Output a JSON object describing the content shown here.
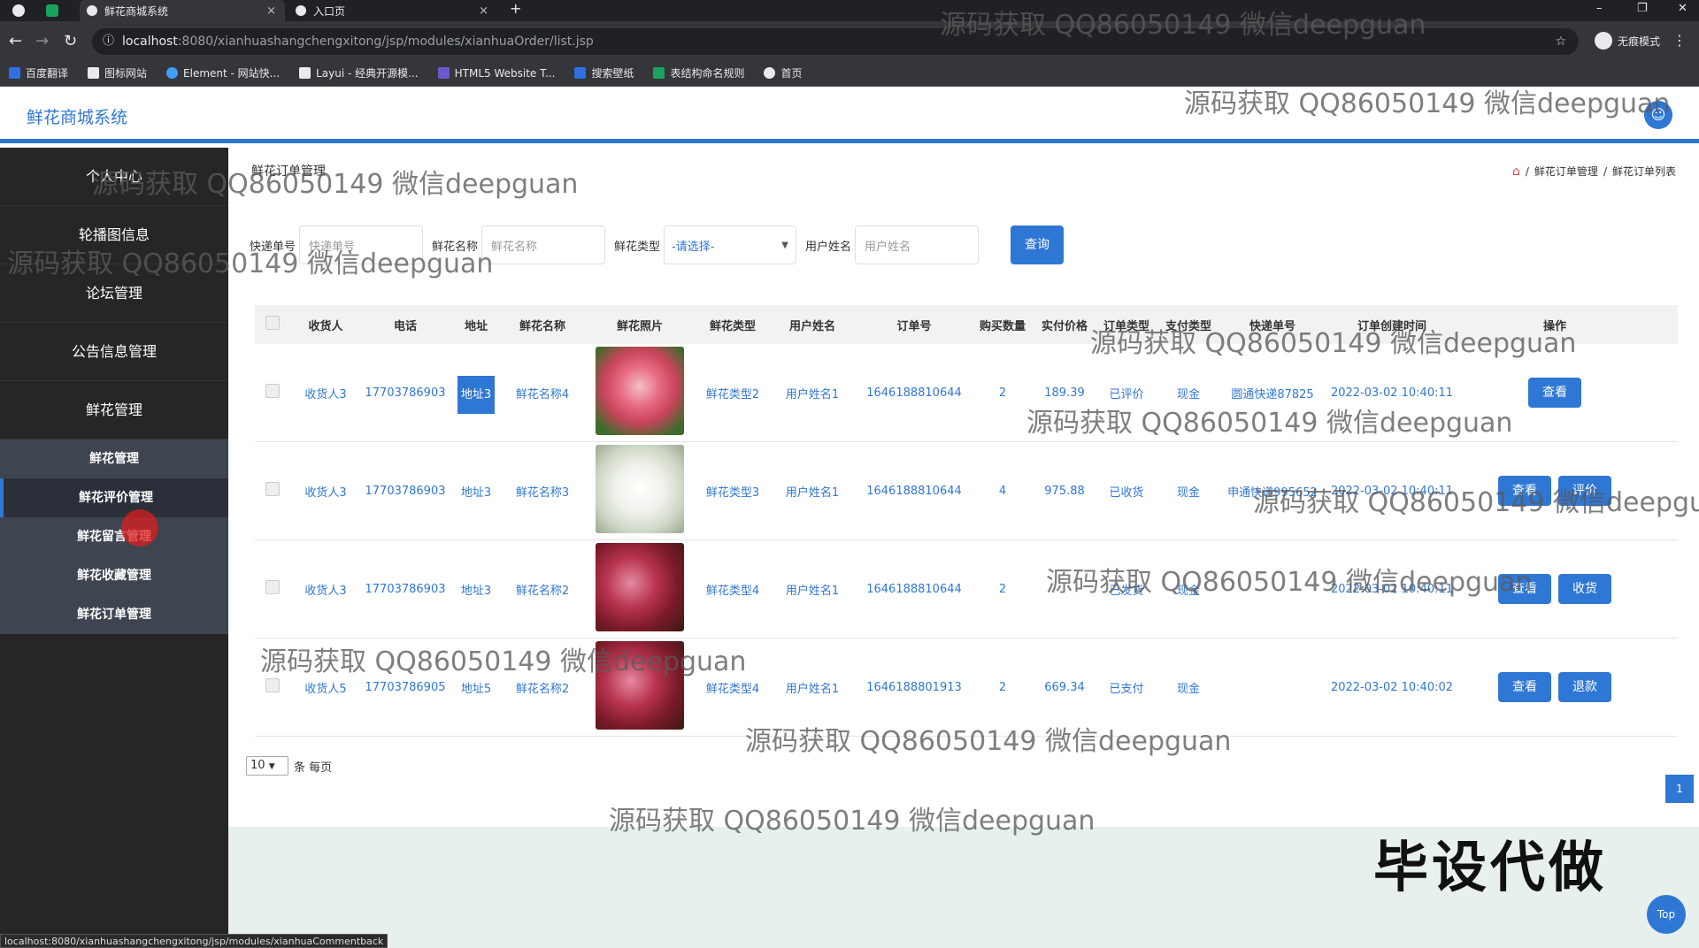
{
  "browser": {
    "tabs": [
      {
        "title": "鲜花商城系统",
        "close": "×"
      },
      {
        "title": "入口页",
        "close": "×"
      }
    ],
    "new_tab": "+",
    "window_controls": [
      "–",
      "❐",
      "✕"
    ],
    "url_host": "localhost",
    "url_path": ":8080/xianhuashangchengxitong/jsp/modules/xianhuaOrder/list.jsp",
    "incognito_label": "无痕模式",
    "bookmarks": [
      {
        "label": "百度翻译",
        "color": "#2f6fe0"
      },
      {
        "label": "图标网站",
        "color": "#e8eaed"
      },
      {
        "label": "Element - 网站快...",
        "color": "#409eff"
      },
      {
        "label": "Layui - 经典开源模...",
        "color": "#e8eaed"
      },
      {
        "label": "HTML5 Website T...",
        "color": "#6a5acd"
      },
      {
        "label": "搜索壁纸",
        "color": "#2f6fe0"
      },
      {
        "label": "表结构命名规则",
        "color": "#1aa260"
      },
      {
        "label": "首页",
        "color": "#e8eaed"
      }
    ],
    "status_url": "localhost:8080/xianhuashangchengxitong/jsp/modules/xianhuaCommentback"
  },
  "header": {
    "title": "鲜花商城系统",
    "avatar_icon": "user-icon"
  },
  "sidebar": {
    "items": [
      {
        "label": "个人中心"
      },
      {
        "label": "轮播图信息"
      },
      {
        "label": "论坛管理"
      },
      {
        "label": "公告信息管理"
      },
      {
        "label": "鲜花管理"
      }
    ],
    "subitems": [
      {
        "label": "鲜花管理"
      },
      {
        "label": "鲜花评价管理"
      },
      {
        "label": "鲜花留言管理"
      },
      {
        "label": "鲜花收藏管理"
      },
      {
        "label": "鲜花订单管理"
      }
    ]
  },
  "main": {
    "page_title": "鲜花订单管理",
    "breadcrumb": [
      "鲜花订单管理",
      "鲜花订单列表"
    ],
    "breadcrumb_sep": "/",
    "search": {
      "fields": [
        {
          "label": "快递单号",
          "placeholder": "快递单号"
        },
        {
          "label": "鲜花名称",
          "placeholder": "鲜花名称"
        },
        {
          "label": "鲜花类型",
          "select": "-请选择-"
        },
        {
          "label": "用户姓名",
          "placeholder": "用户姓名"
        }
      ],
      "button": "查询"
    },
    "columns": [
      "收货人",
      "电话",
      "地址",
      "鲜花名称",
      "鲜花照片",
      "鲜花类型",
      "用户姓名",
      "订单号",
      "购买数量",
      "实付价格",
      "订单类型",
      "支付类型",
      "快递单号",
      "订单创建时间",
      "操作"
    ],
    "rows": [
      {
        "receiver": "收货人3",
        "phone": "17703786903",
        "address": "地址3",
        "flower": "鲜花名称4",
        "type": "鲜花类型2",
        "user": "用户姓名1",
        "order_no": "1646188810644",
        "qty": "2",
        "price": "189.39",
        "status": "已评价",
        "pay": "现金",
        "express": "圆通快递87825",
        "time": "2022-03-02 10:40:11",
        "actions": [
          "查看"
        ],
        "photo_color": "#c8445a"
      },
      {
        "receiver": "收货人3",
        "phone": "17703786903",
        "address": "地址3",
        "flower": "鲜花名称3",
        "type": "鲜花类型3",
        "user": "用户姓名1",
        "order_no": "1646188810644",
        "qty": "4",
        "price": "975.88",
        "status": "已收货",
        "pay": "现金",
        "express": "申通快递995652",
        "time": "2022-03-02 10:40:11",
        "actions": [
          "查看",
          "评价"
        ],
        "photo_color": "#e9ede6"
      },
      {
        "receiver": "收货人3",
        "phone": "17703786903",
        "address": "地址3",
        "flower": "鲜花名称2",
        "type": "鲜花类型4",
        "user": "用户姓名1",
        "order_no": "1646188810644",
        "qty": "2",
        "price": "",
        "status": "已发货",
        "pay": "现金",
        "express": "",
        "time": "2022-03-02 10:40:11",
        "actions": [
          "查看",
          "收货"
        ],
        "photo_color": "#8a1f2c"
      },
      {
        "receiver": "收货人5",
        "phone": "17703786905",
        "address": "地址5",
        "flower": "鲜花名称2",
        "type": "鲜花类型4",
        "user": "用户姓名1",
        "order_no": "1646188801913",
        "qty": "2",
        "price": "669.34",
        "status": "已支付",
        "pay": "现金",
        "express": "",
        "time": "2022-03-02 10:40:02",
        "actions": [
          "查看",
          "退款"
        ],
        "photo_color": "#8a1f2c"
      }
    ],
    "page_size": "10",
    "page_size_suffix": "条 每页",
    "current_page": "1",
    "top_label": "Top"
  },
  "overlay": {
    "big_text": "毕设代做",
    "watermark": "源码获取 QQ86050149 微信deepguan"
  }
}
